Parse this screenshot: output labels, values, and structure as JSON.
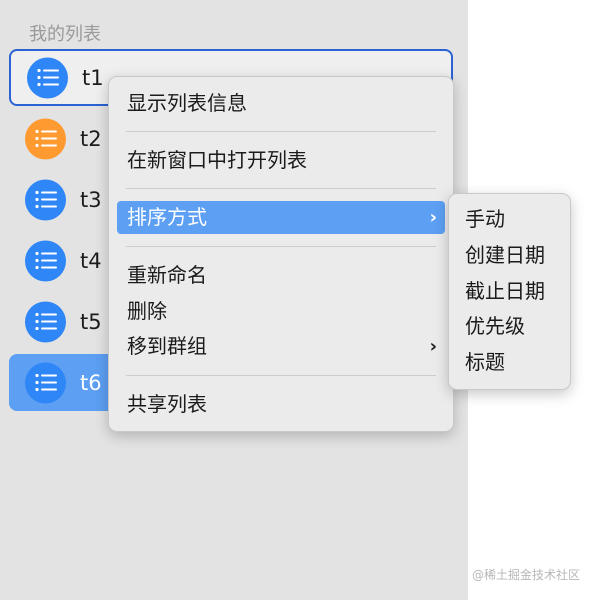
{
  "colors": {
    "blue_icon": "#2f86f6",
    "orange_icon": "#fe9a30",
    "selection": "#5c9ff3",
    "focus_ring": "#2b62d4"
  },
  "sidebar": {
    "section_title": "我的列表",
    "lists": [
      {
        "name": "t1",
        "icon": "list-bullet-icon",
        "color": "blue"
      },
      {
        "name": "t2",
        "icon": "list-bullet-icon",
        "color": "orange"
      },
      {
        "name": "t3",
        "icon": "list-bullet-icon",
        "color": "blue"
      },
      {
        "name": "t4",
        "icon": "list-bullet-icon",
        "color": "blue"
      },
      {
        "name": "t5",
        "icon": "list-bullet-icon",
        "color": "blue"
      },
      {
        "name": "t6",
        "icon": "list-bullet-icon",
        "color": "blue"
      }
    ]
  },
  "context_menu": {
    "items": [
      {
        "label": "显示列表信息"
      },
      {
        "label": "在新窗口中打开列表"
      },
      {
        "label": "排序方式",
        "submenu_icon": "chevron-right-icon"
      },
      {
        "label": "重新命名"
      },
      {
        "label": "删除"
      },
      {
        "label": "移到群组",
        "submenu_icon": "chevron-right-icon"
      },
      {
        "label": "共享列表"
      }
    ]
  },
  "sort_submenu": {
    "items": [
      {
        "label": "手动"
      },
      {
        "label": "创建日期"
      },
      {
        "label": "截止日期"
      },
      {
        "label": "优先级"
      },
      {
        "label": "标题"
      }
    ]
  },
  "watermark": "@稀土掘金技术社区"
}
